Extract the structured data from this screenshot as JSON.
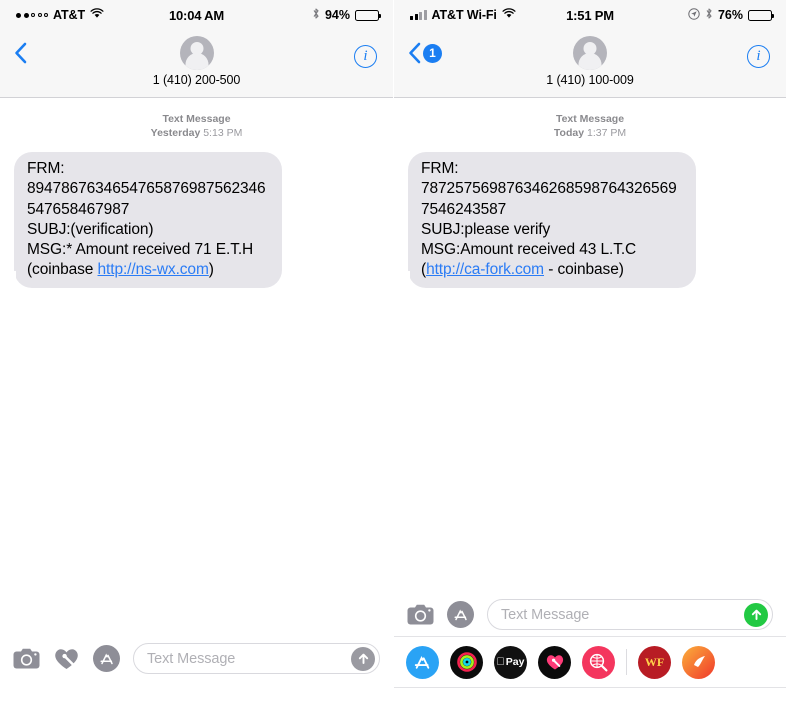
{
  "left": {
    "status": {
      "carrier": "AT&T",
      "signal_type": "dots",
      "signal_filled": 2,
      "signal_total": 5,
      "wifi_icon": "wifi-icon",
      "time": "10:04 AM",
      "bluetooth_icon": "bluetooth-icon",
      "battery_percent": "94%",
      "battery_level": 94
    },
    "nav": {
      "back_icon": "chevron-left-icon",
      "back_badge": "",
      "avatar_icon": "contact-avatar",
      "contact_name": "1 (410) 200-500",
      "info_label": "i"
    },
    "timestamp": {
      "service": "Text Message",
      "date": "Yesterday",
      "time": "5:13 PM"
    },
    "message": {
      "line1": "FRM:",
      "line2": "8947867634654765876987562346547658467987",
      "line3": "SUBJ:(verification)",
      "line4": "MSG:* Amount received 71 E.T.H (coinbase ",
      "link": "http://ns-wx.com",
      "line5": ")"
    },
    "toolbar": {
      "camera_icon": "camera-icon",
      "digital_touch_icon": "digital-touch-heart-icon",
      "appstore_icon": "app-store-icon",
      "input_placeholder": "Text Message",
      "send_icon": "send-arrow-up-icon",
      "send_color": "#9a9aa1"
    }
  },
  "right": {
    "status": {
      "carrier": "AT&T Wi-Fi",
      "signal_type": "bars",
      "signal_filled": 2,
      "signal_total": 4,
      "wifi_icon": "wifi-icon",
      "time": "1:51 PM",
      "location_icon": "location-arrow-icon",
      "bluetooth_icon": "bluetooth-icon",
      "battery_percent": "76%",
      "battery_level": 76
    },
    "nav": {
      "back_icon": "chevron-left-icon",
      "back_badge": "1",
      "avatar_icon": "contact-avatar",
      "contact_name": "1 (410) 100-009",
      "info_label": "i"
    },
    "timestamp": {
      "service": "Text Message",
      "date": "Today",
      "time": "1:37 PM"
    },
    "message": {
      "line1": "FRM:",
      "line2": "7872575698763462685987643265697546243587",
      "line3": "SUBJ:please verify",
      "line4": "MSG:Amount received 43 L.T.C (",
      "link": "http://ca-fork.com",
      "line5": " - coinbase)"
    },
    "toolbar": {
      "camera_icon": "camera-icon",
      "appstore_icon": "app-store-icon",
      "input_placeholder": "Text Message",
      "send_icon": "send-arrow-up-icon",
      "send_color": "#22c943"
    },
    "app_drawer": [
      {
        "name": "app-store-app",
        "label": "",
        "bg": "#2aa3f5"
      },
      {
        "name": "activity-rings-app",
        "label": "",
        "bg": "#0b0b0b"
      },
      {
        "name": "apple-pay-app",
        "label": "Pay",
        "bg": "#111111"
      },
      {
        "name": "digital-touch-app",
        "label": "",
        "bg": "#0b0b0b"
      },
      {
        "name": "image-search-app",
        "label": "",
        "bg": "#f4365e"
      },
      {
        "name": "wells-fargo-app",
        "label": "WF",
        "bg": "#b81c24"
      },
      {
        "name": "orange-gradient-app",
        "label": "",
        "bg": "#f6892a"
      }
    ]
  },
  "colors": {
    "bubble_bg": "#e6e5ea",
    "link": "#2b7cf5",
    "accent_blue": "#1b7ef2",
    "send_green": "#22c943",
    "chrome_bg": "#f7f7f7"
  }
}
